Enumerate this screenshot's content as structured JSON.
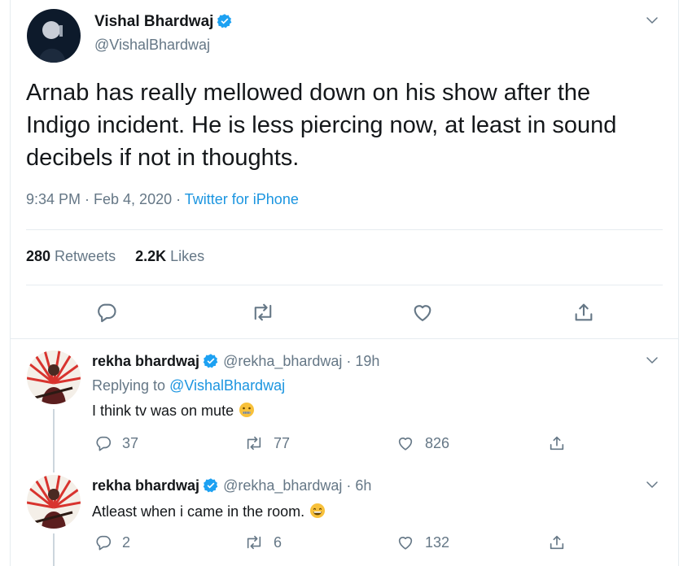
{
  "tweet": {
    "author_name": "Vishal Bhardwaj",
    "author_handle": "@VishalBhardwaj",
    "text": "Arnab has really mellowed down on his show after the Indigo incident. He is less piercing now, at least in sound decibels if not in thoughts.",
    "time": "9:34 PM · Feb 4, 2020 · ",
    "source": "Twitter for iPhone",
    "retweets_count": "280",
    "retweets_label": " Retweets",
    "likes_count": "2.2K",
    "likes_label": " Likes"
  },
  "replies": [
    {
      "author_name": "rekha bhardwaj",
      "handle_time": "@rekha_bhardwaj · 19h",
      "replying_label": "Replying to ",
      "replying_to": "@VishalBhardwaj",
      "text": "I think tv was on mute",
      "emoji": "zipper-mouth-face",
      "reply_count": "37",
      "retweet_count": "77",
      "like_count": "826"
    },
    {
      "author_name": "rekha bhardwaj",
      "handle_time": "@rekha_bhardwaj · 6h",
      "text": "Atleast when i came in the room.",
      "emoji": "grinning-face",
      "reply_count": "2",
      "retweet_count": "6",
      "like_count": "132"
    }
  ],
  "colors": {
    "link": "#1b95e0",
    "secondary_text": "#657786",
    "divider": "#e6ecf0",
    "verified": "#1da1f2"
  }
}
